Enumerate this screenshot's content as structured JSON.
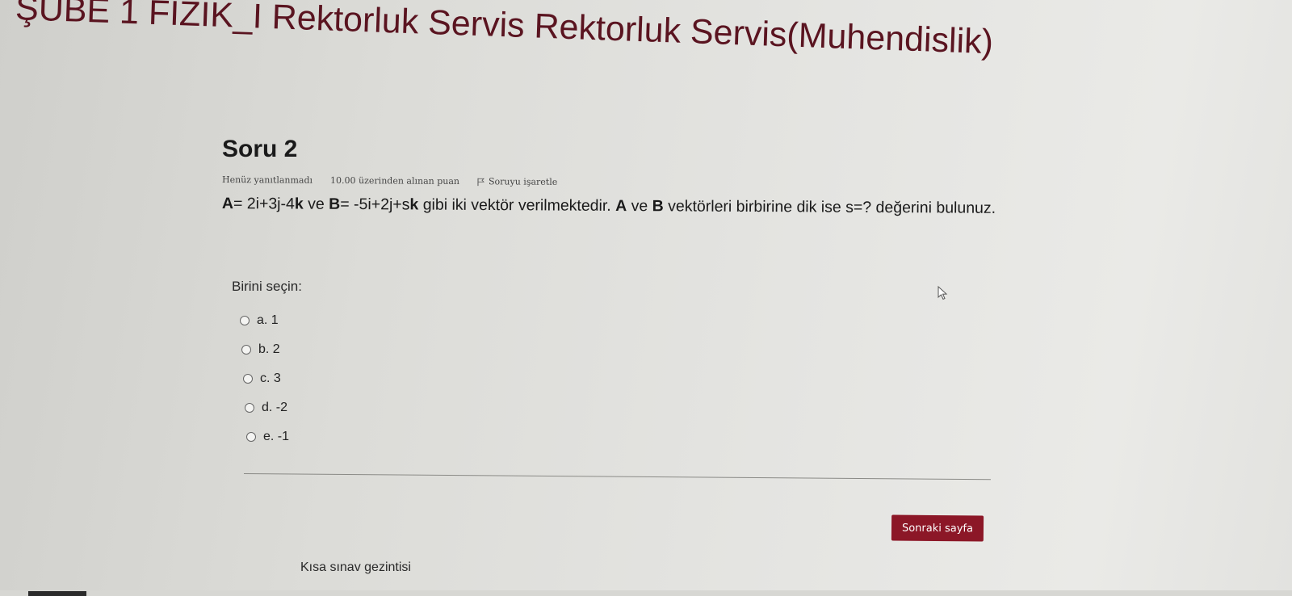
{
  "header": {
    "course_title": "ŞUBE 1 FİZİK_I Rektorluk Servis Rektorluk Servis(Muhendislik)"
  },
  "question": {
    "number_label": "Soru 2",
    "status": "Henüz yanıtlanmadı",
    "marks": "10.00 üzerinden alınan puan",
    "flag_label": "Soruyu işaretle",
    "text": {
      "a_label": "A",
      "a_expr": "= 2i+3j-4",
      "a_k": "k",
      "ve1": " ve ",
      "b_label": "B",
      "b_expr": "= -5i+2j+s",
      "b_k": "k",
      "middle": " gibi iki vektör verilmektedir. ",
      "a_label2": "A",
      "ve2": " ve ",
      "b_label2": "B",
      "end": " vektörleri birbirine dik ise s=? değerini bulunuz."
    }
  },
  "answers": {
    "prompt": "Birini seçin:",
    "options": [
      {
        "label": "a. 1"
      },
      {
        "label": "b. 2"
      },
      {
        "label": "c. 3"
      },
      {
        "label": "d. -2"
      },
      {
        "label": "e. -1"
      }
    ]
  },
  "navigation": {
    "next_label": "Sonraki sayfa",
    "quiz_nav_title": "Kısa sınav gezintisi"
  },
  "icons": {
    "flag": "flag-icon",
    "cursor": "mouse-pointer-icon"
  },
  "colors": {
    "brand": "#8c1727",
    "title": "#5a1420"
  }
}
